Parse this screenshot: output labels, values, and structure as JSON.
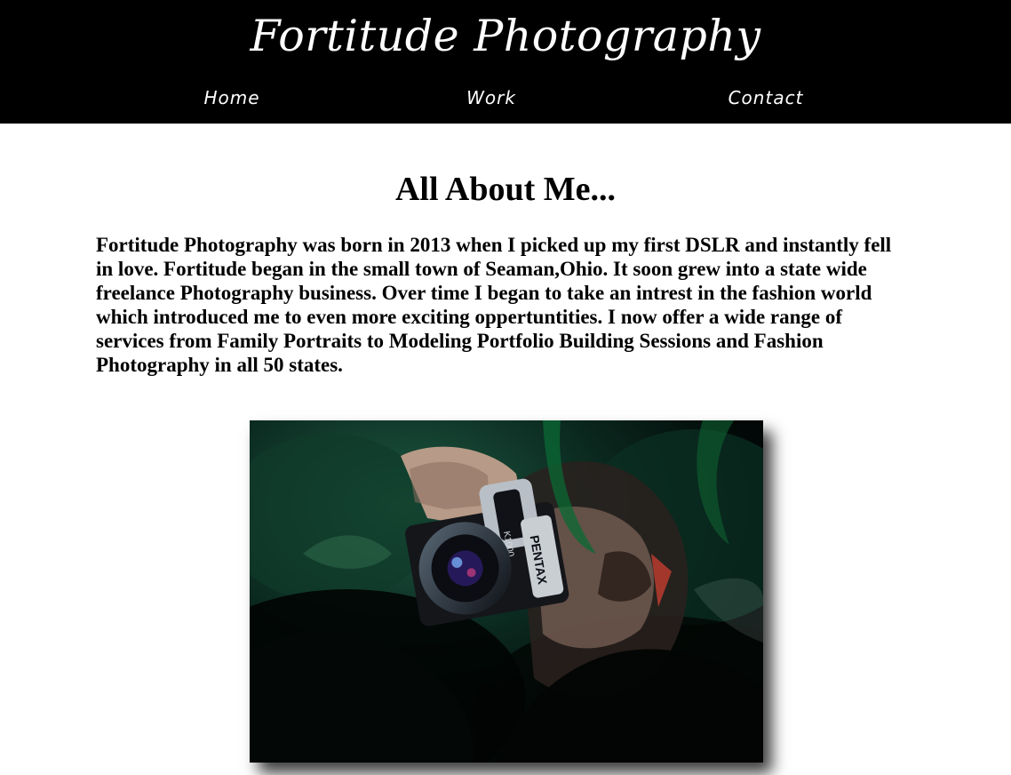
{
  "header": {
    "brand": "Fortitude Photography",
    "background_color": "#000000",
    "text_color": "#ffffff"
  },
  "nav": {
    "items": [
      {
        "label": "Home"
      },
      {
        "label": "Work"
      },
      {
        "label": "Contact"
      }
    ]
  },
  "main": {
    "title": "All About Me...",
    "body": "Fortitude Photography was born in 2013 when I picked up my first DSLR and instantly fell in love. Fortitude began in the small town of Seaman,Ohio. It soon grew into a state wide freelance Photography business. Over time I began to take an intrest in the fashion world which introduced me to even more exciting oppertuntities. I now offer a wide range of services from Family Portraits to Modeling Portfolio Building Sessions and Fashion Photography in all 50 states."
  },
  "photo": {
    "icon": "camera-portrait-image",
    "camera_brand": "PENTAX",
    "camera_model": "K1000"
  }
}
